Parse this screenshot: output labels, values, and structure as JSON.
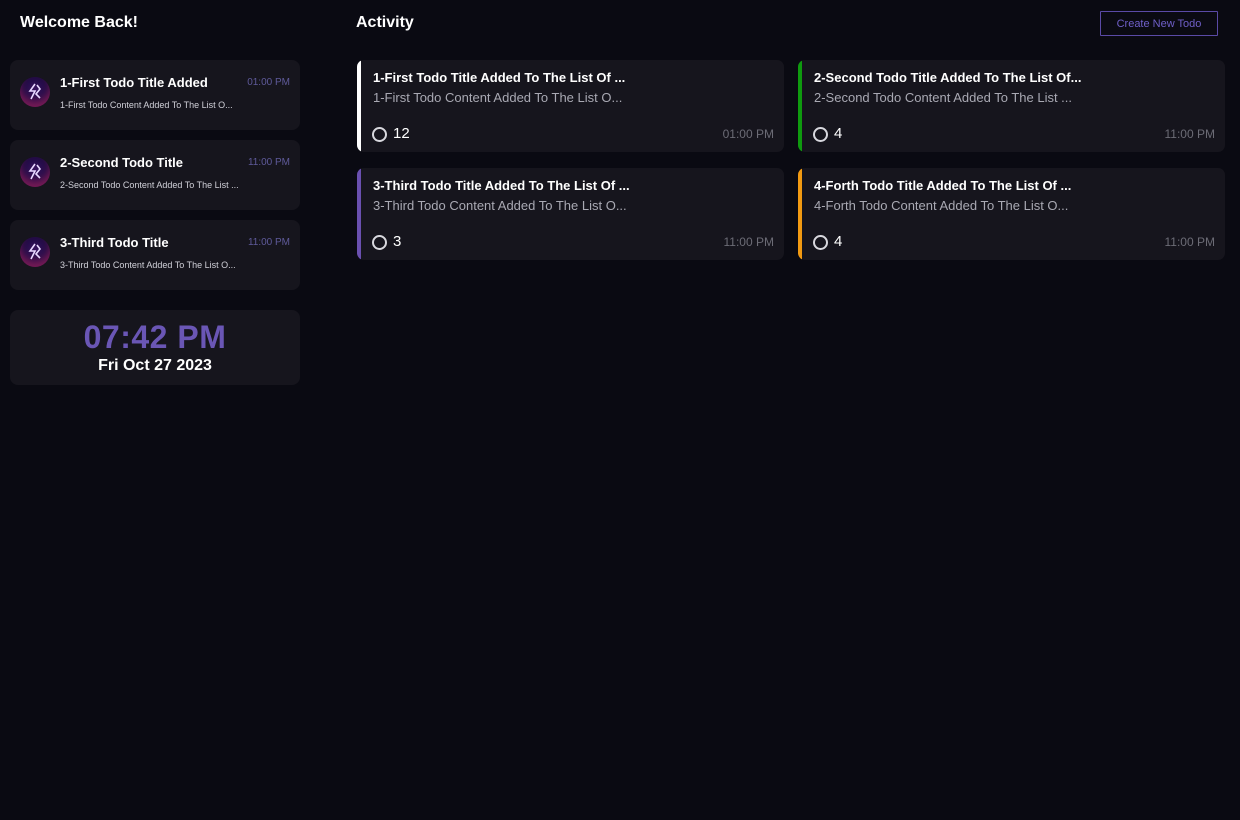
{
  "sidebar": {
    "greeting": "Welcome Back!",
    "recent": [
      {
        "title": "1-First Todo Title Added",
        "time": "01:00 PM",
        "content": "1-First Todo Content Added To The List O..."
      },
      {
        "title": "2-Second Todo Title",
        "time": "11:00 PM",
        "content": "2-Second Todo Content Added To The List ..."
      },
      {
        "title": "3-Third Todo Title",
        "time": "11:00 PM",
        "content": "3-Third Todo Content Added To The List O..."
      }
    ],
    "clock": {
      "time": "07:42 PM",
      "date": "Fri Oct 27 2023"
    }
  },
  "main": {
    "title": "Activity",
    "create_button": "Create New Todo",
    "cards": [
      {
        "title": "1-First Todo Title Added To The List Of ...",
        "content": "1-First Todo Content Added To The List O...",
        "count": "12",
        "time": "01:00 PM",
        "accent": "#ffffff"
      },
      {
        "title": "2-Second Todo Title Added To The List Of...",
        "content": "2-Second Todo Content Added To The List ...",
        "count": "4",
        "time": "11:00 PM",
        "accent": "#0f9a0f"
      },
      {
        "title": "3-Third Todo Title Added To The List Of ...",
        "content": "3-Third Todo Content Added To The List O...",
        "count": "3",
        "time": "11:00 PM",
        "accent": "#6a50b0"
      },
      {
        "title": "4-Forth Todo Title Added To The List Of ...",
        "content": "4-Forth Todo Content Added To The List O...",
        "count": "4",
        "time": "11:00 PM",
        "accent": "#f29a12"
      }
    ]
  },
  "icons": {
    "avatar": "logo-avatar-icon",
    "check": "circle-checkbox-icon"
  },
  "colors": {
    "background": "#0a0a12",
    "card": "#16151d",
    "accent_purple": "#6a56b5"
  }
}
